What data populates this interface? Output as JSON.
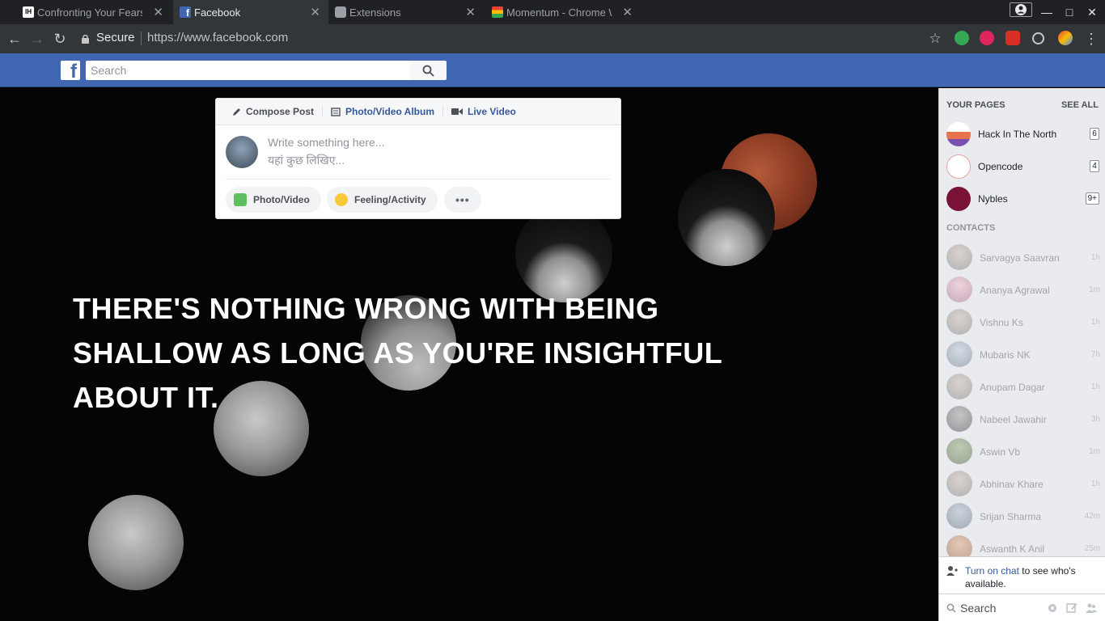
{
  "browser": {
    "tabs": [
      {
        "title": "Confronting Your Fears",
        "icon": "ih-favicon"
      },
      {
        "title": "Facebook",
        "icon": "facebook-favicon"
      },
      {
        "title": "Extensions",
        "icon": "puzzle-favicon"
      },
      {
        "title": "Momentum - Chrome W",
        "icon": "momentum-favicon"
      }
    ],
    "secure_label": "Secure",
    "url": "https://www.facebook.com"
  },
  "fb": {
    "search_placeholder": "Search"
  },
  "composer": {
    "tab_compose": "Compose Post",
    "tab_album": "Photo/Video Album",
    "tab_live": "Live Video",
    "placeholder_en": "Write something here...",
    "placeholder_hi": "यहां कुछ लिखिए...",
    "btn_photo": "Photo/Video",
    "btn_feeling": "Feeling/Activity",
    "btn_more": "•••"
  },
  "quote": "THERE'S NOTHING WRONG WITH BEING SHALLOW AS LONG AS YOU'RE INSIGHTFUL ABOUT IT.",
  "sidebar": {
    "pages_header": "YOUR PAGES",
    "see_all": "SEE ALL",
    "pages": [
      {
        "name": "Hack In The North",
        "count": "6"
      },
      {
        "name": "Opencode",
        "count": "4"
      },
      {
        "name": "Nybles",
        "count": "9+"
      }
    ],
    "contacts_header": "CONTACTS",
    "contacts": [
      {
        "name": "Sarvagya Saavran",
        "time": "1h"
      },
      {
        "name": "Ananya Agrawal",
        "time": "1m"
      },
      {
        "name": "Vishnu Ks",
        "time": "1h"
      },
      {
        "name": "Mubaris NK",
        "time": "7h"
      },
      {
        "name": "Anupam Dagar",
        "time": "1h"
      },
      {
        "name": "Nabeel Jawahir",
        "time": "3h"
      },
      {
        "name": "Aswin Vb",
        "time": "1m"
      },
      {
        "name": "Abhinav Khare",
        "time": "1h"
      },
      {
        "name": "Srijan Sharma",
        "time": "42m"
      },
      {
        "name": "Aswanth K Anil",
        "time": "25m"
      }
    ],
    "chat_link": "Turn on chat",
    "chat_text": " to see who's available.",
    "chat_search_placeholder": "Search"
  },
  "colors": {
    "fb_blue": "#4267b2",
    "link_blue": "#365899",
    "chrome_dark": "#202124"
  }
}
